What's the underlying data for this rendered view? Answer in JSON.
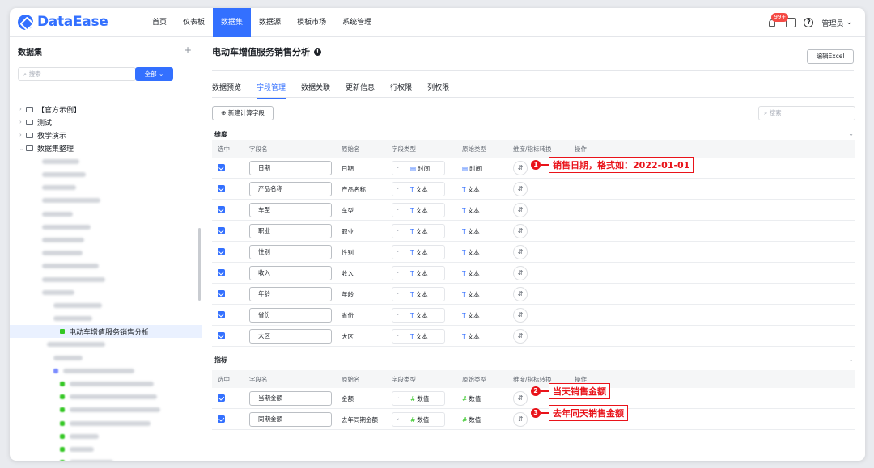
{
  "app": {
    "logo": "DataEase"
  },
  "nav": {
    "items": [
      "首页",
      "仪表板",
      "数据集",
      "数据源",
      "模板市场",
      "系统管理"
    ],
    "active_index": 2
  },
  "topbar": {
    "badge": "99+",
    "help": "?",
    "user": "管理员",
    "user_chevron": "⌄"
  },
  "sidebar": {
    "title": "数据集",
    "add": "+",
    "search_placeholder": "搜索",
    "filter_label": "全部 ⌄",
    "tree": [
      {
        "label": "【官方示例】",
        "arrow": "›"
      },
      {
        "label": "测试",
        "arrow": "›"
      },
      {
        "label": "教学演示",
        "arrow": "›"
      },
      {
        "label": "数据集整理",
        "arrow": "⌄"
      }
    ],
    "selected_dataset": "电动车增值服务销售分析"
  },
  "main": {
    "title": "电动车增值服务销售分析",
    "info_icon": "!",
    "excel_button": "编辑Excel",
    "tabs": [
      "数据预览",
      "字段管理",
      "数据关联",
      "更新信息",
      "行权限",
      "列权限"
    ],
    "active_tab": 1,
    "new_field_button": "⊕ 新建计算字段",
    "search_placeholder": "搜索",
    "columns": [
      "选中",
      "字段名",
      "原始名",
      "字段类型",
      "原始类型",
      "维度/指标转换",
      "操作"
    ],
    "dimension_label": "维度",
    "measure_label": "指标",
    "dimensions": [
      {
        "name": "日期",
        "orig": "日期",
        "type": "时间",
        "orig_type": "时间",
        "glyph": "▤"
      },
      {
        "name": "产品名称",
        "orig": "产品名称",
        "type": "文本",
        "orig_type": "文本",
        "glyph": "T"
      },
      {
        "name": "车型",
        "orig": "车型",
        "type": "文本",
        "orig_type": "文本",
        "glyph": "T"
      },
      {
        "name": "职业",
        "orig": "职业",
        "type": "文本",
        "orig_type": "文本",
        "glyph": "T"
      },
      {
        "name": "性别",
        "orig": "性别",
        "type": "文本",
        "orig_type": "文本",
        "glyph": "T"
      },
      {
        "name": "收入",
        "orig": "收入",
        "type": "文本",
        "orig_type": "文本",
        "glyph": "T"
      },
      {
        "name": "年龄",
        "orig": "年龄",
        "type": "文本",
        "orig_type": "文本",
        "glyph": "T"
      },
      {
        "name": "省份",
        "orig": "省份",
        "type": "文本",
        "orig_type": "文本",
        "glyph": "T"
      },
      {
        "name": "大区",
        "orig": "大区",
        "type": "文本",
        "orig_type": "文本",
        "glyph": "T"
      }
    ],
    "measures": [
      {
        "name": "当期金额",
        "orig": "金额",
        "type": "数值",
        "orig_type": "数值",
        "glyph": "#"
      },
      {
        "name": "同期金额",
        "orig": "去年同期金额",
        "type": "数值",
        "orig_type": "数值",
        "glyph": "#"
      }
    ],
    "convert_glyph": "⇵",
    "select_arrow": "⌄"
  },
  "callouts": [
    {
      "num": "1",
      "text": "销售日期，格式如：2022-01-01"
    },
    {
      "num": "2",
      "text": "当天销售金额"
    },
    {
      "num": "3",
      "text": "去年同天销售金额"
    }
  ],
  "colors": {
    "accent": "#3370ff",
    "callout": "#e9131a",
    "numeric": "#34c724"
  }
}
